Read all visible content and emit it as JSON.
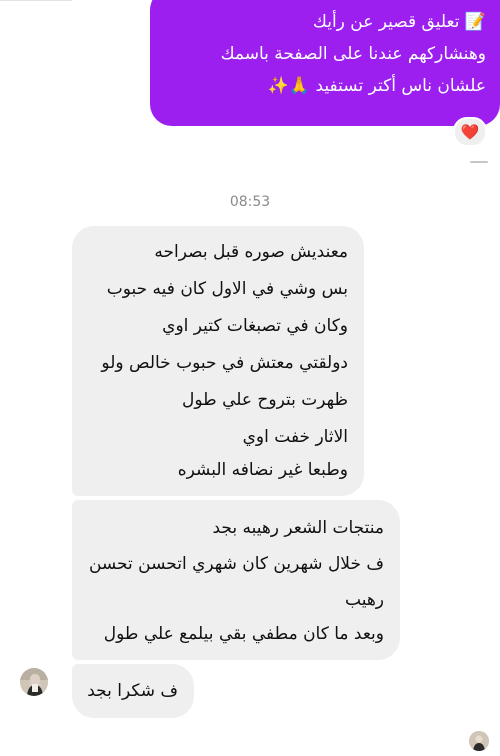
{
  "sent_message": {
    "lines": [
      "📝 تعليق قصير عن رأيك",
      "وهنشاركهم عندنا على الصفحة باسمك",
      "علشان ناس أكتر تستفيد 🙏✨"
    ],
    "reaction": "❤️"
  },
  "timestamp": "08:53",
  "received_messages": [
    {
      "lines": [
        "معنديش صوره قبل بصراحه",
        "بس وشي في الاول كان فيه حبوب",
        "وكان في تصبغات كتير اوي",
        "دولقتي معتش في حبوب  خالص ولو",
        "ظهرت بتروح علي طول",
        "الاثار خفت اوي",
        "وطبعا غير نضافه البشره"
      ]
    },
    {
      "lines": [
        "منتجات الشعر رهيبه بجد",
        "ف خلال شهرين كان شهري اتحسن تحسن",
        "رهيب",
        "وبعد ما كان مطفي بقي بيلمع علي طول"
      ]
    },
    {
      "lines": [
        "ف شكرا بجد"
      ]
    }
  ],
  "icons": {
    "avatar": "user-avatar-photo"
  }
}
